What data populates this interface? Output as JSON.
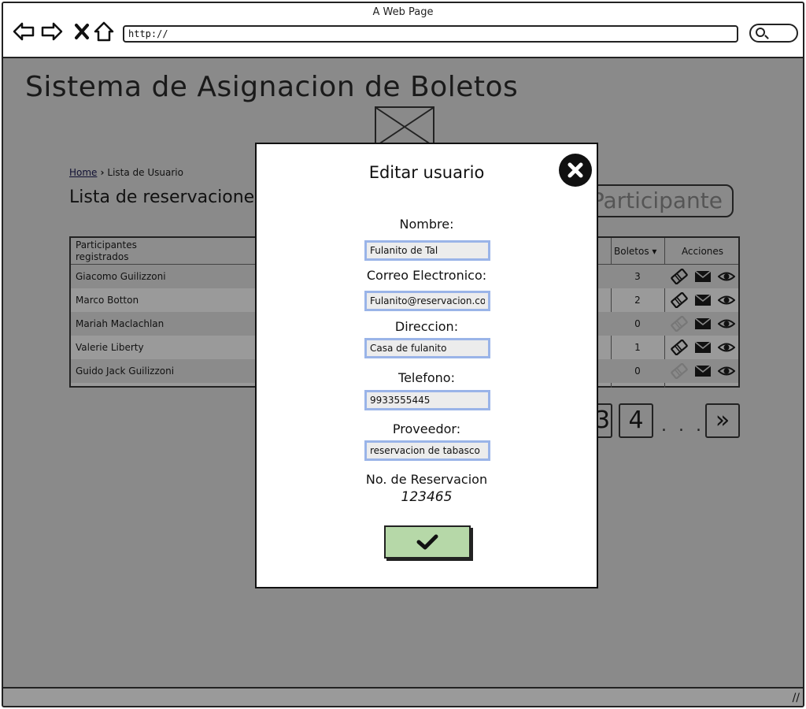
{
  "browser": {
    "window_title": "A Web Page",
    "url": "http://"
  },
  "page": {
    "title": "Sistema de Asignacion de Boletos",
    "breadcrumb": {
      "home": "Home",
      "current": "Lista de Usuario"
    },
    "section_title": "Lista de reservacione",
    "add_button": "Participante"
  },
  "table": {
    "headers": {
      "participants": "Participantes registrados",
      "tickets": "Boletos",
      "actions": "Acciones"
    },
    "rows": [
      {
        "name": "Giacomo Guilizzoni",
        "tickets": "3",
        "ticket_icon_active": true
      },
      {
        "name": "Marco Botton",
        "tickets": "2",
        "ticket_icon_active": true
      },
      {
        "name": "Mariah Maclachlan",
        "tickets": "0",
        "ticket_icon_active": false
      },
      {
        "name": "Valerie Liberty",
        "tickets": "1",
        "ticket_icon_active": true
      },
      {
        "name": "Guido Jack Guilizzoni",
        "tickets": "0",
        "ticket_icon_active": false
      }
    ]
  },
  "pagination": {
    "partial": "3",
    "page_4": "4",
    "ellipsis": ". . .",
    "next": "»"
  },
  "modal": {
    "title": "Editar usuario",
    "fields": {
      "nombre_label": "Nombre:",
      "nombre_value": "Fulanito de Tal",
      "correo_label": "Correo Electronico:",
      "correo_value": "Fulanito@reservacion.com",
      "direccion_label": "Direccion:",
      "direccion_value": "Casa de fulanito",
      "telefono_label": "Telefono:",
      "telefono_value": "9933555445",
      "proveedor_label": "Proveedor:",
      "proveedor_value": "reservacion de tabasco"
    },
    "reservation_label": "No. de Reservacion",
    "reservation_value": "123465"
  },
  "colors": {
    "overlay": "#8a8a8a",
    "input_border": "#9ab4e8",
    "confirm_bg": "#b6d8a8"
  },
  "icons": [
    "back-arrow-icon",
    "forward-arrow-icon",
    "stop-icon",
    "home-icon",
    "search-icon",
    "ticket-icon",
    "mail-icon",
    "eye-icon",
    "close-icon",
    "checkmark-icon",
    "sort-caret-icon",
    "resize-grip-icon"
  ]
}
